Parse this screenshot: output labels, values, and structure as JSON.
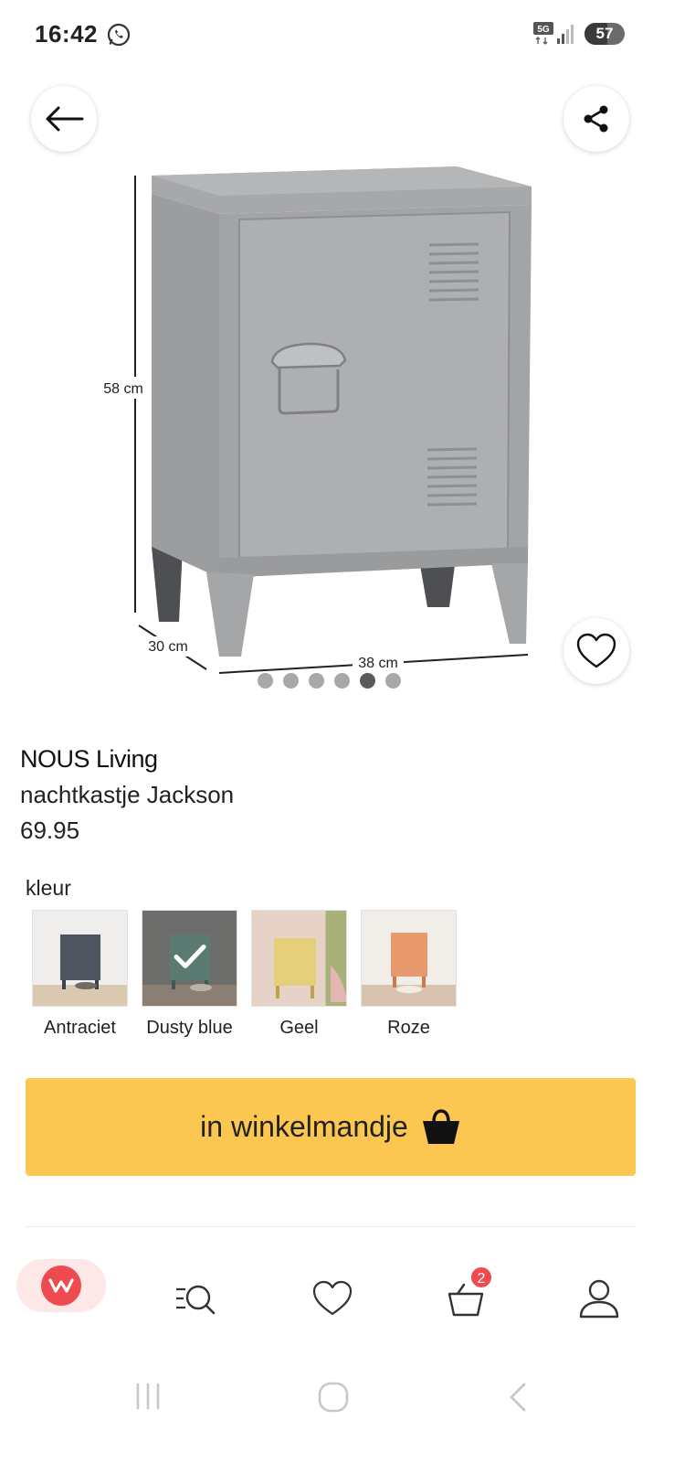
{
  "status_bar": {
    "time": "16:42",
    "network": "5G",
    "battery_level": "57",
    "battery_fraction": 0.57
  },
  "header": {
    "back_icon": "arrow-left-icon",
    "share_icon": "share-icon"
  },
  "gallery": {
    "dimensions": {
      "height": "58 cm",
      "depth": "30 cm",
      "width": "38 cm"
    },
    "image_count": 6,
    "active_index": 4,
    "favorite_icon": "heart-icon"
  },
  "product": {
    "brand": "NOUS Living",
    "name": "nachtkastje Jackson",
    "price": "69.95"
  },
  "colors": {
    "label": "kleur",
    "selected": "Dusty blue",
    "options": [
      {
        "label": "Antraciet",
        "color": "#4f5660"
      },
      {
        "label": "Dusty blue",
        "color": "#5b7a72"
      },
      {
        "label": "Geel",
        "color": "#e6cf7a"
      },
      {
        "label": "Roze",
        "color": "#e89a6e"
      }
    ]
  },
  "cart_button": {
    "label": "in winkelmandje",
    "icon": "shopping-bag-icon",
    "color": "#fcc751"
  },
  "bottom_nav": {
    "items": [
      {
        "name": "home",
        "icon": "wehkamp-logo-icon"
      },
      {
        "name": "search",
        "icon": "search-menu-icon"
      },
      {
        "name": "wishlist",
        "icon": "heart-icon"
      },
      {
        "name": "cart",
        "icon": "basket-icon",
        "badge": "2"
      },
      {
        "name": "account",
        "icon": "user-icon"
      }
    ],
    "accent_color": "#ef4a4f"
  },
  "system_nav": {
    "recents_icon": "recents-icon",
    "home_icon": "home-icon",
    "back_icon": "back-chevron-icon"
  }
}
